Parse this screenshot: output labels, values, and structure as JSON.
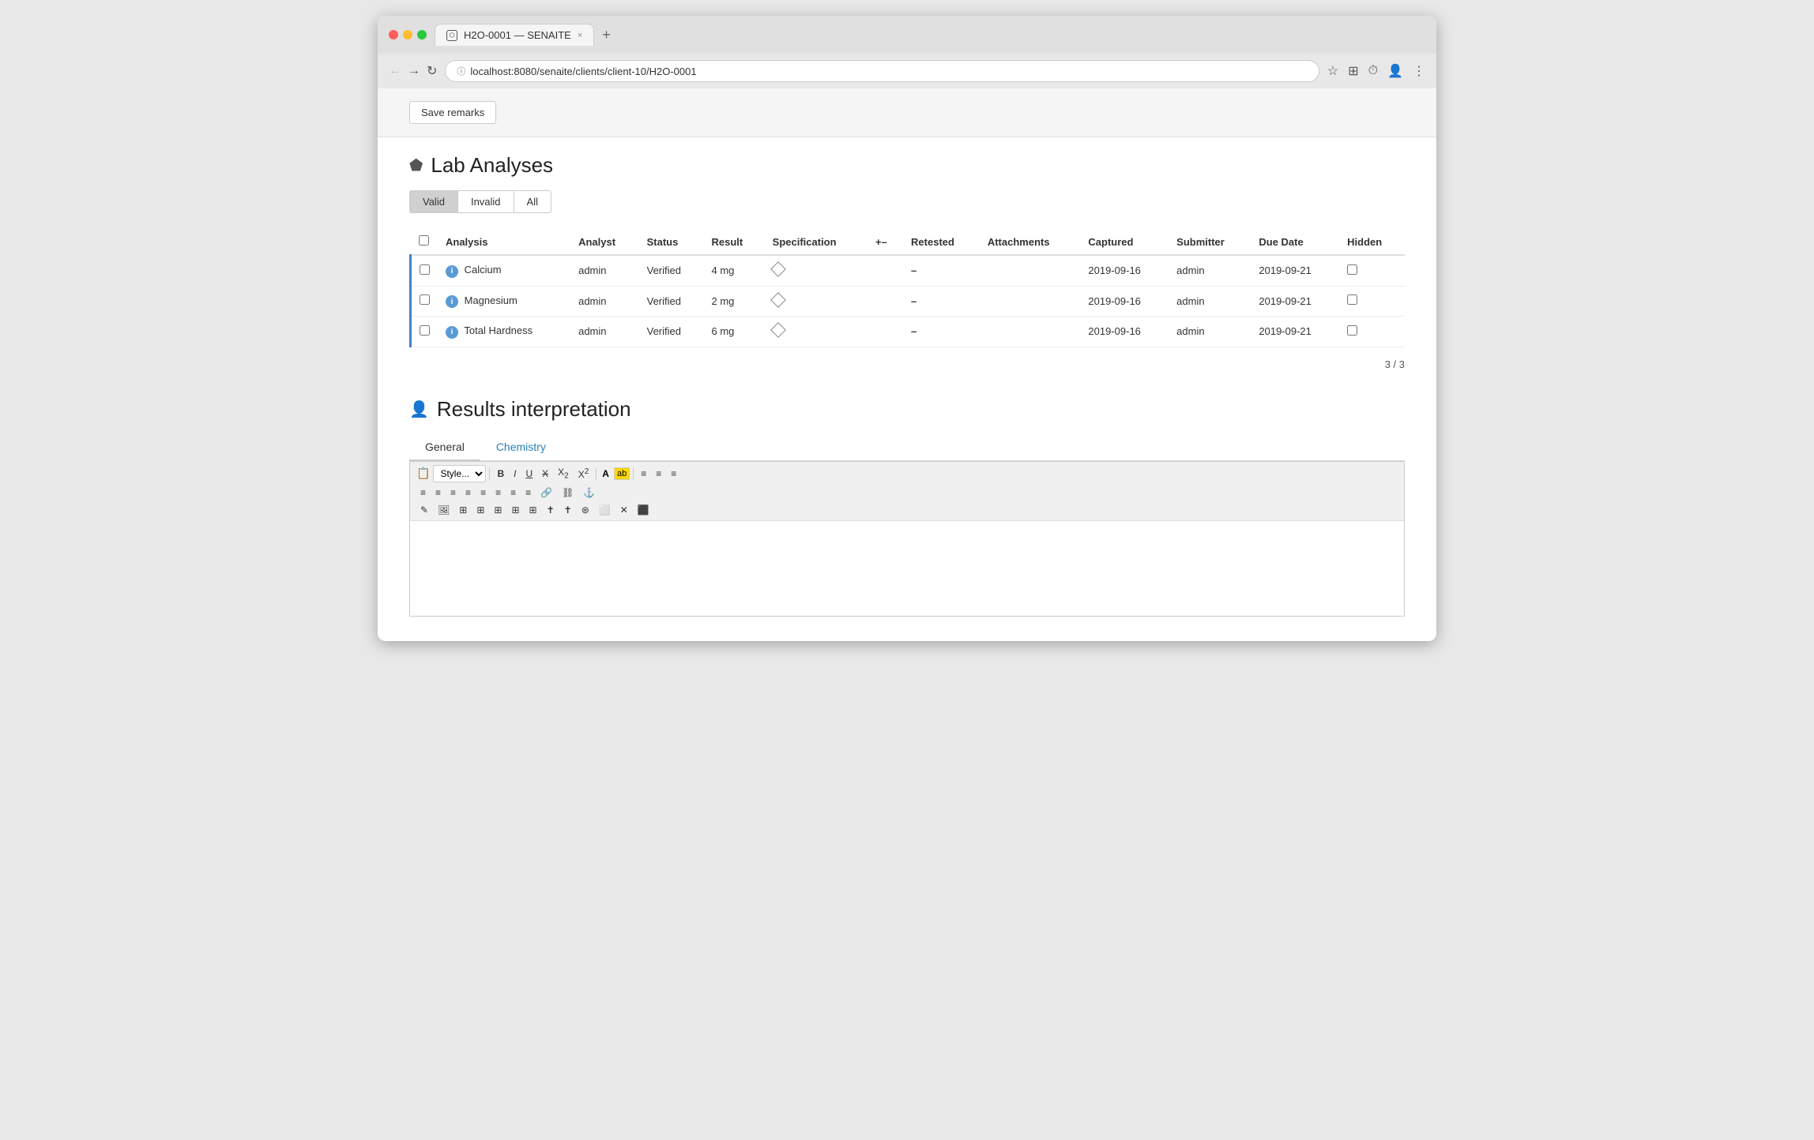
{
  "browser": {
    "tab_title": "H2O-0001 — SENAITE",
    "url": "localhost:8080/senaite/clients/client-10/H2O-0001",
    "new_tab_label": "+",
    "close_label": "×"
  },
  "save_remarks": {
    "label": "Save remarks"
  },
  "lab_analyses": {
    "title": "Lab Analyses",
    "filters": [
      "Valid",
      "Invalid",
      "All"
    ],
    "active_filter": "Valid",
    "columns": [
      "Analysis",
      "Analyst",
      "Status",
      "Result",
      "Specification",
      "+-",
      "Retested",
      "Attachments",
      "Captured",
      "Submitter",
      "Due Date",
      "Hidden"
    ],
    "rows": [
      {
        "analysis": "Calcium",
        "analyst": "admin",
        "status": "Verified",
        "result": "4 mg",
        "specification": "",
        "pm": "",
        "retested": "–",
        "attachments": "",
        "captured": "2019-09-16",
        "submitter": "admin",
        "due_date": "2019-09-21",
        "hidden": ""
      },
      {
        "analysis": "Magnesium",
        "analyst": "admin",
        "status": "Verified",
        "result": "2 mg",
        "specification": "",
        "pm": "",
        "retested": "–",
        "attachments": "",
        "captured": "2019-09-16",
        "submitter": "admin",
        "due_date": "2019-09-21",
        "hidden": ""
      },
      {
        "analysis": "Total Hardness",
        "analyst": "admin",
        "status": "Verified",
        "result": "6 mg",
        "specification": "",
        "pm": "",
        "retested": "–",
        "attachments": "",
        "captured": "2019-09-16",
        "submitter": "admin",
        "due_date": "2019-09-21",
        "hidden": ""
      }
    ],
    "pagination": "3 / 3"
  },
  "results_interpretation": {
    "title": "Results interpretation",
    "tabs": [
      {
        "label": "General",
        "active": true
      },
      {
        "label": "Chemistry",
        "active": false
      }
    ],
    "editor": {
      "style_placeholder": "Style...",
      "toolbar_buttons": [
        "B",
        "I",
        "U",
        "X₂",
        "X²",
        "A",
        "ab",
        "≡",
        "≡",
        "≡",
        "≡",
        "≡",
        "≡",
        "≡",
        "≡",
        "≡",
        "⚓"
      ]
    }
  }
}
